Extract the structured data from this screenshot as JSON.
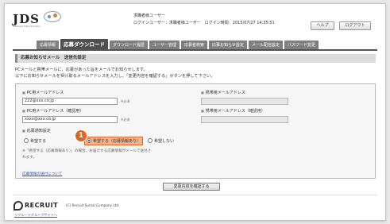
{
  "header": {
    "logo_text": "JDS",
    "logo_sub": "Jobboard Data Solution",
    "user_line_1": "求職者様ユーザー",
    "user_line_2": "ログインユーザー：求職者様ユーザー　ログイン時間：2015/07/27 14:35:51",
    "help_label": "ヘルプ",
    "logout_label": "ログアウト"
  },
  "tabs": [
    {
      "label": "応募情報",
      "active": false
    },
    {
      "label": "応募ダウンロード",
      "active": true
    },
    {
      "label": "ダウンロード履歴",
      "active": false
    },
    {
      "label": "ユーザー管理",
      "active": false
    },
    {
      "label": "応募者検索",
      "active": false
    },
    {
      "label": "応募お知らせ設定",
      "active": false
    },
    {
      "label": "メール配信設定",
      "active": false
    },
    {
      "label": "パスワード変更",
      "active": false
    }
  ],
  "section": {
    "title": "応募お知らせメール　送信先設定",
    "desc_line_1": "PCメールと携帯メールに、応募があった旨をメールでお知らせします。",
    "desc_line_2": "以下にお知らせメールを受け取るメールアドレスを入力し、「変更内容を確認する」ボタンを押して下さい。"
  },
  "form": {
    "pc_label": "PC用メールアドレス",
    "pc_value": "222@xxx.co.jp",
    "pc_hint": "※必須",
    "pc_confirm_label": "PC用メールアドレス（確認用）",
    "pc_confirm_value": "xxxx@xxx.co.jp",
    "pc_confirm_hint": "※必須",
    "mobile_label": "携帯用メールアドレス",
    "mobile_value": "",
    "mobile_confirm_label": "携帯用メールアドレス（確認用）",
    "mobile_confirm_value": "",
    "notify_label": "応募通知設定",
    "radio_1": "希望する",
    "radio_2": "希望する（応募情報あり）",
    "radio_3": "希望しない",
    "callout_number": "1",
    "note_line_1": "※「希望する（応募情報あり）」の場合、お届けする応募情報がメールで送付さ",
    "note_line_2": "れます。",
    "link_label": "応募情報の送付について"
  },
  "submit_label": "変更内容を確認する",
  "footer": {
    "brand": "RECRUIT",
    "copyright": "(C) Recruit Sumai Company Ltd.",
    "group_link": "リクルートグループサイトへ"
  }
}
